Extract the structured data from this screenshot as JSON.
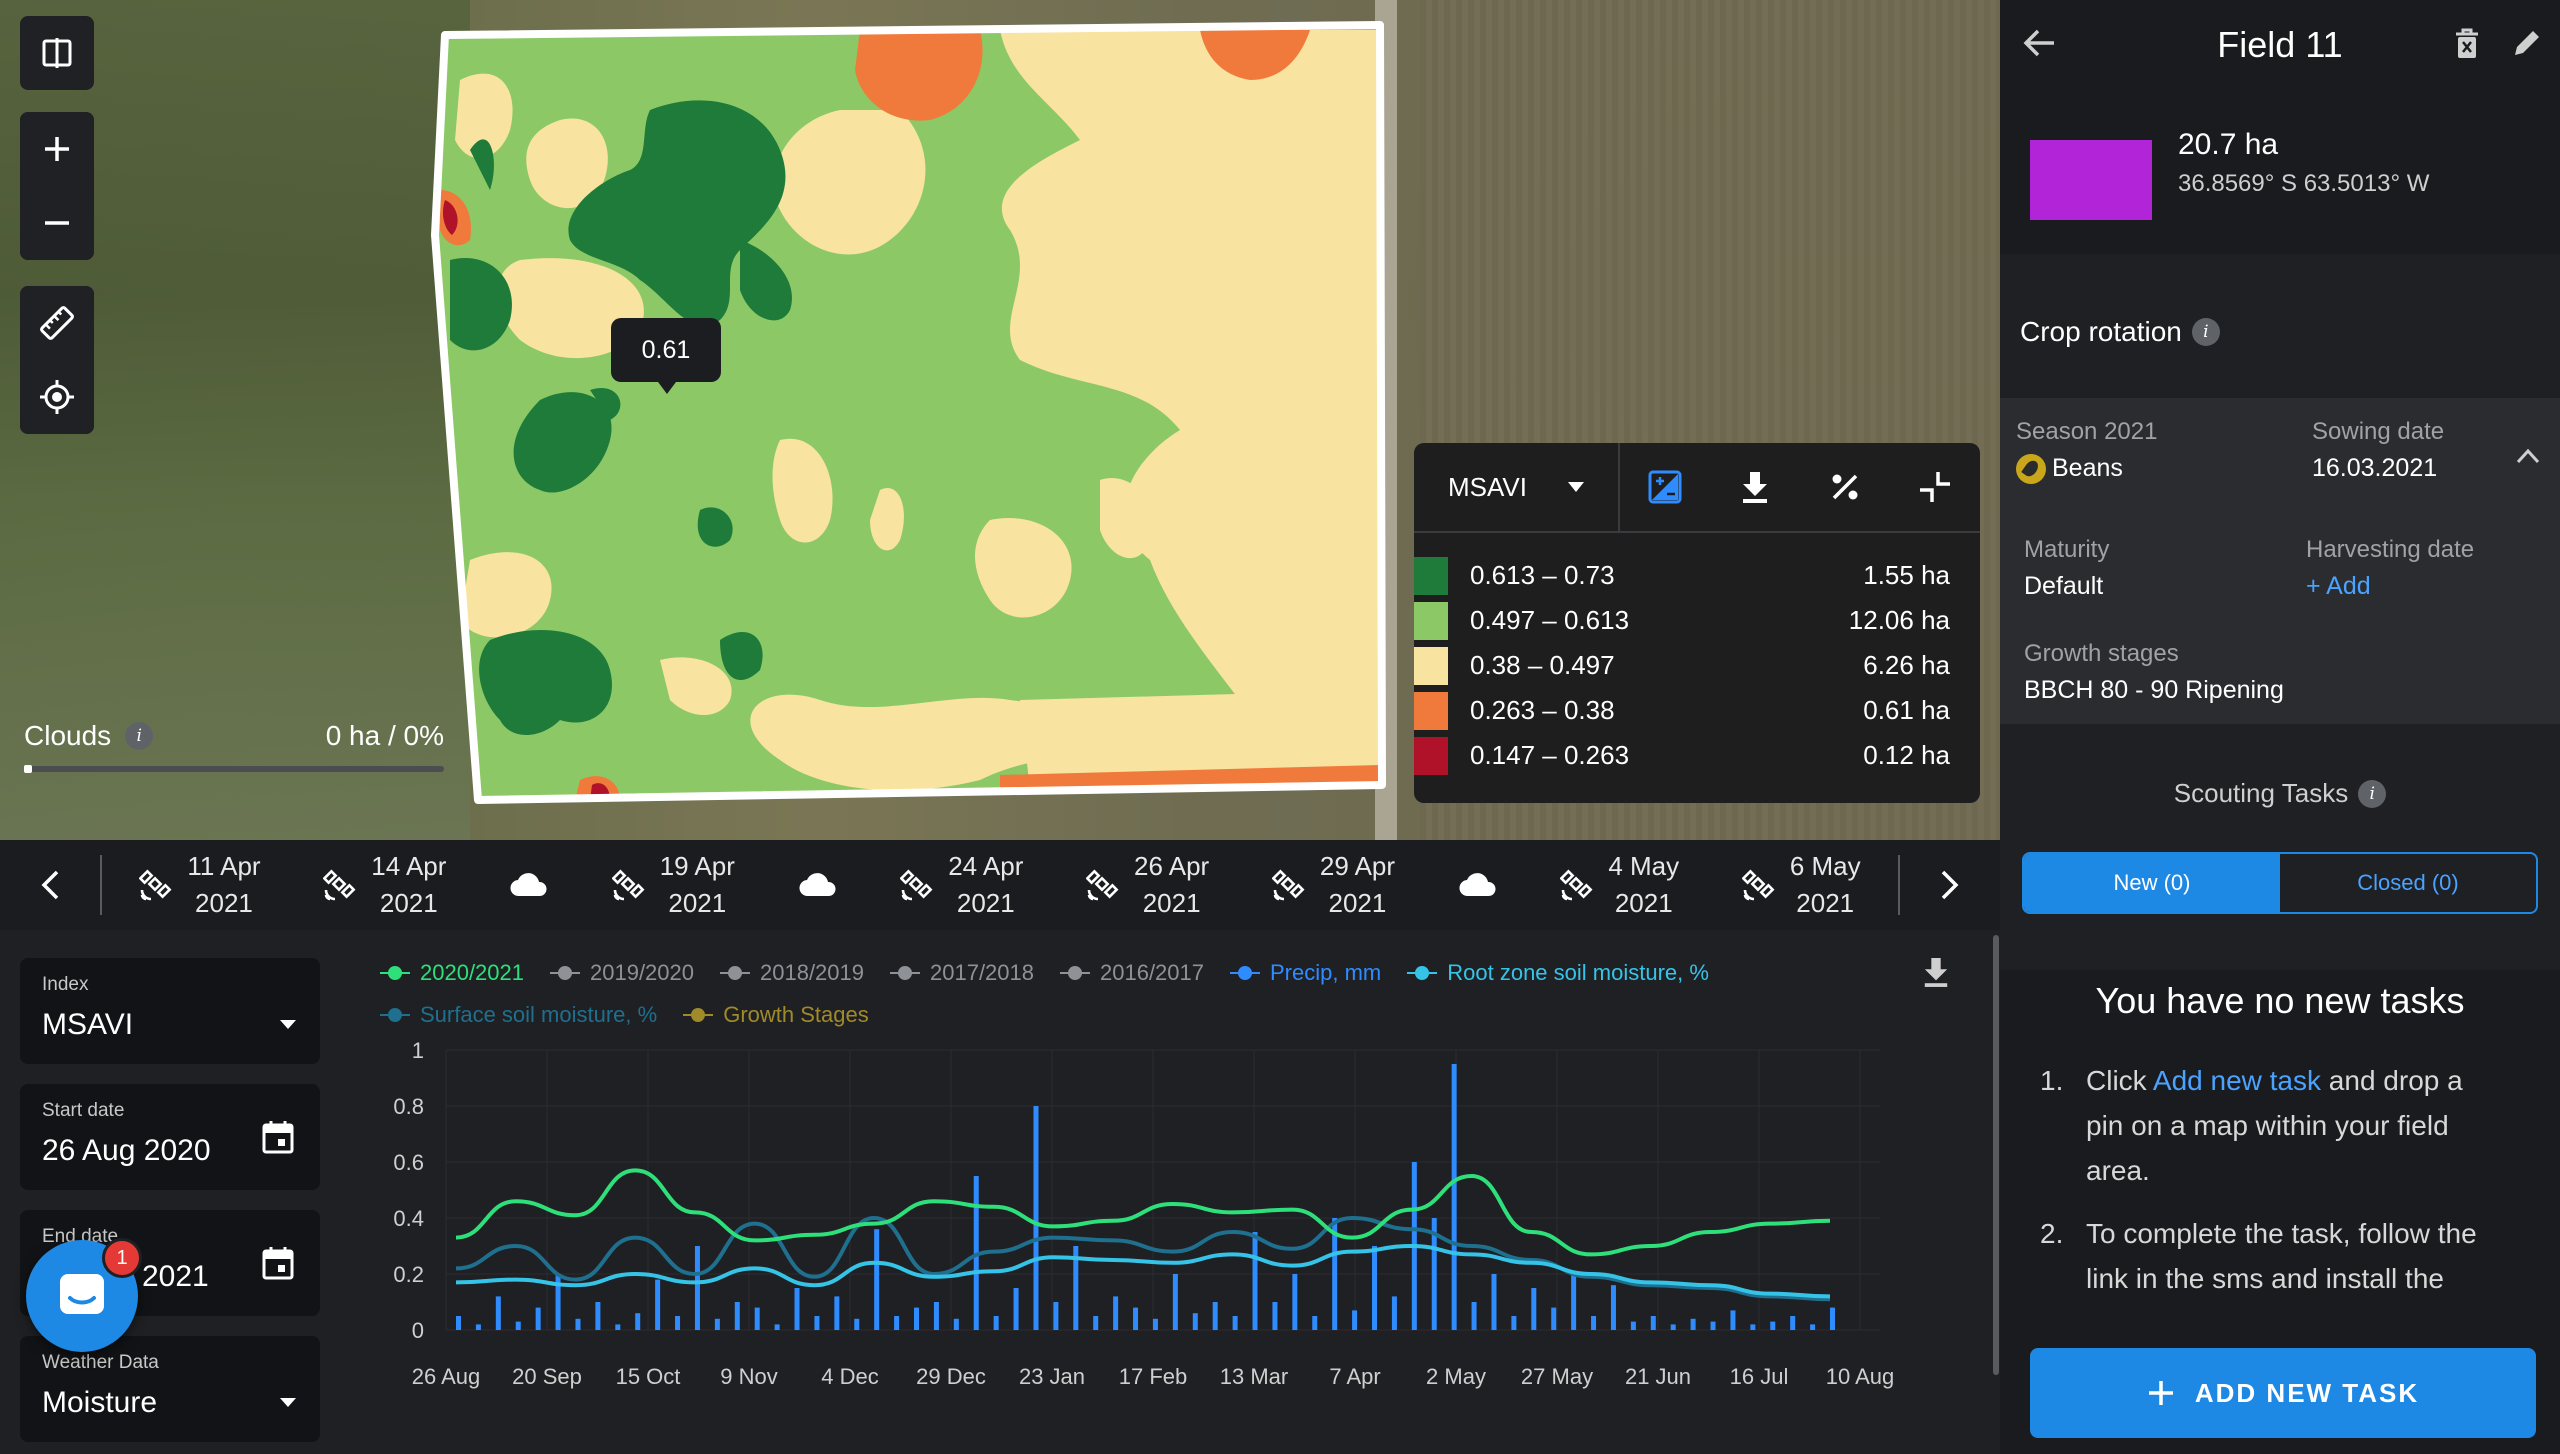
{
  "map": {
    "tooltip_value": "0.61",
    "clouds_label": "Clouds",
    "clouds_value": "0 ha / 0%"
  },
  "legend": {
    "index": "MSAVI",
    "rows": [
      {
        "range": "0.613 – 0.73",
        "area": "1.55 ha",
        "color": "#1e7b3a"
      },
      {
        "range": "0.497 – 0.613",
        "area": "12.06 ha",
        "color": "#8cc966"
      },
      {
        "range": "0.38 – 0.497",
        "area": "6.26 ha",
        "color": "#f8e3a0"
      },
      {
        "range": "0.263 – 0.38",
        "area": "0.61 ha",
        "color": "#f07a3c"
      },
      {
        "range": "0.147 – 0.263",
        "area": "0.12 ha",
        "color": "#b0122a"
      }
    ]
  },
  "dates": [
    {
      "icon": "satellite-icon",
      "day": "11 Apr",
      "year": "2021"
    },
    {
      "icon": "satellite-icon",
      "day": "14 Apr",
      "year": "2021"
    },
    {
      "icon": "cloud-icon"
    },
    {
      "icon": "satellite-icon",
      "day": "19 Apr",
      "year": "2021"
    },
    {
      "icon": "cloud-icon"
    },
    {
      "icon": "satellite-icon",
      "day": "24 Apr",
      "year": "2021"
    },
    {
      "icon": "satellite-icon",
      "day": "26 Apr",
      "year": "2021"
    },
    {
      "icon": "satellite-icon",
      "day": "29 Apr",
      "year": "2021"
    },
    {
      "icon": "cloud-icon"
    },
    {
      "icon": "satellite-icon",
      "day": "4 May",
      "year": "2021"
    },
    {
      "icon": "satellite-icon",
      "day": "6 May",
      "year": "2021"
    }
  ],
  "controls": {
    "index_label": "Index",
    "index_value": "MSAVI",
    "start_label": "Start date",
    "start_value": "26 Aug 2020",
    "end_label": "End date",
    "end_value": "2021",
    "weather_label": "Weather Data",
    "weather_value": "Moisture",
    "chat_badge": "1"
  },
  "chart_legend": [
    {
      "label": "2020/2021",
      "color": "#2ee07a"
    },
    {
      "label": "2019/2020",
      "color": "#8e9196"
    },
    {
      "label": "2018/2019",
      "color": "#8e9196"
    },
    {
      "label": "2017/2018",
      "color": "#8e9196"
    },
    {
      "label": "2016/2017",
      "color": "#8e9196"
    },
    {
      "label": "Precip, mm",
      "color": "#2f8cff"
    },
    {
      "label": "Root zone soil moisture, %",
      "color": "#35c4e8"
    },
    {
      "label": "Surface soil moisture, %",
      "color": "#1f6f8f"
    },
    {
      "label": "Growth Stages",
      "color": "#a08a2a"
    }
  ],
  "chart_data": {
    "type": "line",
    "x_labels": [
      "26 Aug",
      "20 Sep",
      "15 Oct",
      "9 Nov",
      "4 Dec",
      "29 Dec",
      "23 Jan",
      "17 Feb",
      "13 Mar",
      "7 Apr",
      "2 May",
      "27 May",
      "21 Jun",
      "16 Jul",
      "10 Aug"
    ],
    "y_ticks": [
      "0",
      "0.2",
      "0.4",
      "0.6",
      "0.8",
      "1"
    ],
    "ylim": [
      0,
      1
    ],
    "series": [
      {
        "name": "2020/2021",
        "color": "#2ee07a",
        "values": [
          0.33,
          0.46,
          0.41,
          0.57,
          0.42,
          0.32,
          0.34,
          0.38,
          0.46,
          0.44,
          0.37,
          0.39,
          0.45,
          0.42,
          0.43,
          0.33,
          0.43,
          0.55,
          0.35,
          0.27,
          0.3,
          0.35,
          0.38,
          0.39
        ]
      },
      {
        "name": "Root zone soil moisture, %",
        "color": "#35c4e8",
        "values": [
          0.17,
          0.18,
          0.16,
          0.2,
          0.17,
          0.22,
          0.16,
          0.24,
          0.19,
          0.21,
          0.26,
          0.25,
          0.24,
          0.27,
          0.23,
          0.28,
          0.3,
          0.27,
          0.24,
          0.2,
          0.17,
          0.16,
          0.13,
          0.12
        ]
      },
      {
        "name": "Surface soil moisture, %",
        "color": "#1f6f8f",
        "values": [
          0.22,
          0.3,
          0.18,
          0.33,
          0.2,
          0.38,
          0.19,
          0.4,
          0.2,
          0.28,
          0.33,
          0.32,
          0.28,
          0.35,
          0.29,
          0.4,
          0.36,
          0.3,
          0.25,
          0.19,
          0.16,
          0.15,
          0.12,
          0.11
        ]
      }
    ],
    "precip": [
      0.05,
      0.02,
      0.12,
      0.03,
      0.08,
      0.2,
      0.04,
      0.1,
      0.02,
      0.06,
      0.18,
      0.05,
      0.3,
      0.04,
      0.1,
      0.08,
      0.02,
      0.15,
      0.05,
      0.12,
      0.04,
      0.36,
      0.05,
      0.08,
      0.1,
      0.04,
      0.55,
      0.05,
      0.15,
      0.8,
      0.1,
      0.3,
      0.05,
      0.12,
      0.08,
      0.04,
      0.2,
      0.06,
      0.1,
      0.05,
      0.35,
      0.1,
      0.2,
      0.05,
      0.4,
      0.07,
      0.3,
      0.12,
      0.6,
      0.4,
      0.95,
      0.1,
      0.2,
      0.05,
      0.15,
      0.08,
      0.2,
      0.05,
      0.16,
      0.03,
      0.05,
      0.02,
      0.04,
      0.03,
      0.07,
      0.02,
      0.03,
      0.05,
      0.02,
      0.08
    ]
  },
  "sidebar": {
    "field_name": "Field 11",
    "area": "20.7 ha",
    "coords": "36.8569° S 63.5013° W",
    "crop_rotation": "Crop rotation",
    "season_label": "Season 2021",
    "crop": "Beans",
    "sowing_label": "Sowing date",
    "sowing_value": "16.03.2021",
    "maturity_label": "Maturity",
    "maturity_value": "Default",
    "harvest_label": "Harvesting date",
    "harvest_value": "+ Add",
    "growth_label": "Growth stages",
    "growth_value": "BBCH 80 - 90 Ripening",
    "scouting_title": "Scouting Tasks",
    "tab_new": "New (0)",
    "tab_closed": "Closed (0)",
    "no_tasks": "You have no new tasks",
    "step1_pre": "Click ",
    "step1_link": "Add new task",
    "step1_post": " and drop a pin on a map within your field area.",
    "step2": "To complete the task, follow the link in the sms and install the",
    "add_task": "ADD NEW TASK"
  }
}
